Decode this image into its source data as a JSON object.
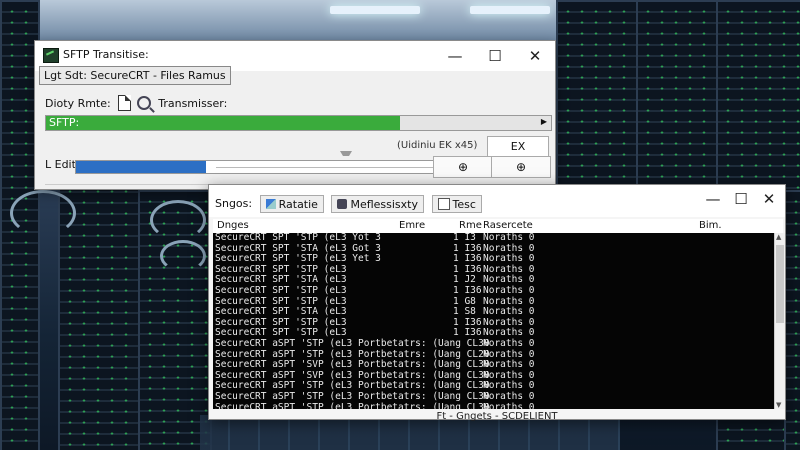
{
  "window1": {
    "title": "SFTP Transitise:",
    "tab": "Lgt Sdt: SecureCRT - Files Ramus",
    "directory_label": "Dioty Rmte:",
    "transmitter_label": "Transmisser:",
    "progress_label": "SFTP:",
    "progress_fraction": 0.7,
    "status_text": "(Uidiniu EK x45)",
    "ex_button": "EX",
    "left_label": "L Edit",
    "slider_fraction": 0.36,
    "button_a": "⊕",
    "button_b": "⊕"
  },
  "window2": {
    "toolbar": {
      "label": "Sngos:",
      "btn1": "Ratatie",
      "btn2": "Meflessisxty",
      "btn3": "Tesc"
    },
    "columns": [
      "Dnges",
      "Emre",
      "Rme",
      "Rasercete",
      "Bim."
    ],
    "rows": [
      {
        "name": "SecureCRT  SPT 'STP (eL3 Yot 3",
        "n": "1 I3",
        "c": "Noraths 0"
      },
      {
        "name": "SecureCRT  SPT 'STA (eL3 Got 3",
        "n": "1 I36",
        "c": "Noraths 0"
      },
      {
        "name": "SecureCRT  SPT 'STP (eL3 Yet 3",
        "n": "1 I36",
        "c": "Noraths 0"
      },
      {
        "name": "SecureCRT  SPT 'STP (eL3",
        "n": "1 I36",
        "c": "Noraths 0"
      },
      {
        "name": "SecureCRT  SPT 'STA (eL3",
        "n": "1 J2",
        "c": "Noraths 0"
      },
      {
        "name": "SecureCRT  SPT 'STP (eL3",
        "n": "1 I36",
        "c": "Noraths 0"
      },
      {
        "name": "SecureCRT  SPT 'STP (eL3",
        "n": "1 G8",
        "c": "Noraths 0"
      },
      {
        "name": "SecureCRT  SPT 'STA (eL3",
        "n": "1 S8",
        "c": "Noraths 0"
      },
      {
        "name": "SecureCRT  SPT 'STP (eL3",
        "n": "1 I36",
        "c": "Noraths 0"
      },
      {
        "name": "SecureCRT  SPT 'STP (eL3",
        "n": "1 I36",
        "c": "Noraths 0"
      },
      {
        "name": "SecureCRT  aSPT 'STP (eL3  Portbetatrs: (Uang CL30",
        "n": "",
        "c": "Noraths 0"
      },
      {
        "name": "SecureCRT  aSPT 'STP (eL3  Portbetatrs: (Uang CL20",
        "n": "",
        "c": "Noraths 0"
      },
      {
        "name": "SecureCRT  aSPT 'SVP (eL3  Portbetatrs: (Uang CL30",
        "n": "",
        "c": "Noraths 0"
      },
      {
        "name": "SecureCRT  aSPT 'SVP (eL3  Portbetatrs: (Uang CL30",
        "n": "",
        "c": "Noraths 0"
      },
      {
        "name": "SecureCRT  aSPT 'STP (eL3  Portbetatrs: (Uang CL30",
        "n": "",
        "c": "Noraths 0"
      },
      {
        "name": "SecureCRT  aSPT 'STP (eL3  Portbetatrs: (Uang CL30",
        "n": "",
        "c": "Noraths 0"
      },
      {
        "name": "SecureCRT  aSPT 'STP (eL3  Portbetatrs: (Uang CL30",
        "n": "",
        "c": "Noraths 0"
      }
    ],
    "status_bar": "Ft - Gngets - SCDELIENT"
  },
  "colors": {
    "progress_green": "#3aab3c",
    "slider_blue": "#2c6fc4",
    "terminal_bg": "#050505"
  }
}
